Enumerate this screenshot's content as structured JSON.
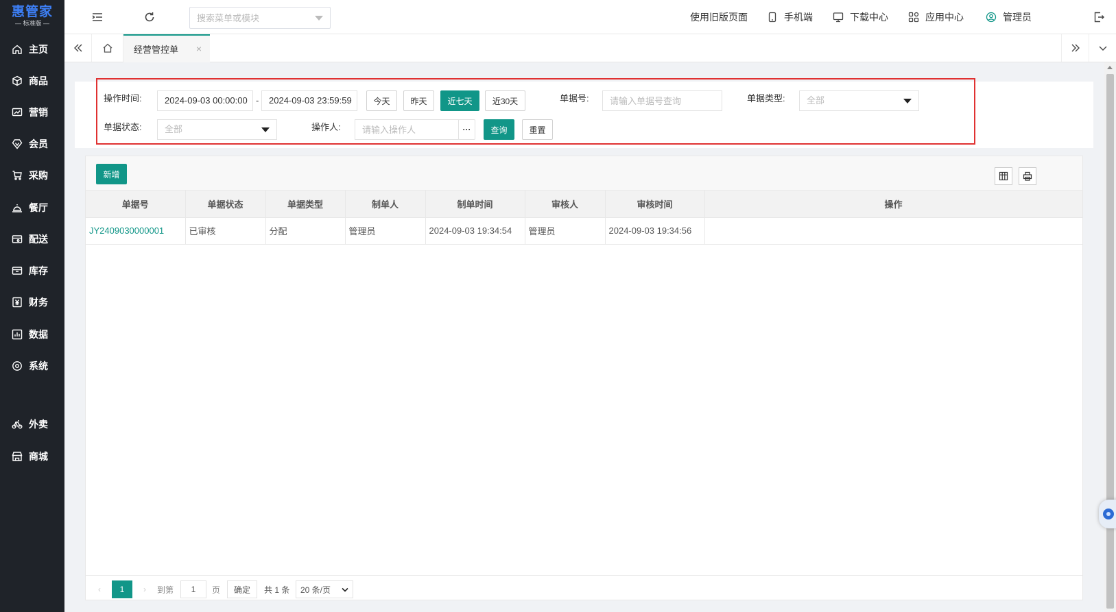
{
  "sidebar": {
    "brand": "惠管家",
    "edition": "— 标准版 —",
    "items": [
      {
        "label": "主页",
        "icon": "home-icon"
      },
      {
        "label": "商品",
        "icon": "cube-icon"
      },
      {
        "label": "营销",
        "icon": "chart-icon"
      },
      {
        "label": "会员",
        "icon": "diamond-icon"
      },
      {
        "label": "采购",
        "icon": "cart-icon"
      },
      {
        "label": "餐厅",
        "icon": "bell-icon"
      },
      {
        "label": "配送",
        "icon": "truck-icon"
      },
      {
        "label": "库存",
        "icon": "box-icon"
      },
      {
        "label": "财务",
        "icon": "yen-icon"
      },
      {
        "label": "数据",
        "icon": "bar-chart-icon"
      },
      {
        "label": "系统",
        "icon": "gear-icon"
      },
      {
        "label": "外卖",
        "icon": "bike-icon"
      },
      {
        "label": "商城",
        "icon": "shop-icon"
      }
    ]
  },
  "topbar": {
    "search_placeholder": "搜索菜单或模块",
    "old_page": "使用旧版页面",
    "mobile": "手机端",
    "download": "下载中心",
    "apps": "应用中心",
    "user": "管理员"
  },
  "tabs": {
    "active": "经营管控单"
  },
  "filter": {
    "op_time_label": "操作时间:",
    "start_time": "2024-09-03 00:00:00",
    "end_time": "2024-09-03 23:59:59",
    "today": "今天",
    "yesterday": "昨天",
    "last7": "近七天",
    "last30": "近30天",
    "doc_no_label": "单据号:",
    "doc_no_placeholder": "请输入单据号查询",
    "doc_type_label": "单据类型:",
    "doc_type_value": "全部",
    "status_label": "单据状态:",
    "status_value": "全部",
    "operator_label": "操作人:",
    "operator_placeholder": "请输入操作人",
    "more": "···",
    "query": "查询",
    "reset": "重置"
  },
  "toolbar": {
    "add": "新增"
  },
  "table": {
    "headers": [
      "单据号",
      "单据状态",
      "单据类型",
      "制单人",
      "制单时间",
      "审核人",
      "审核时间",
      "操作"
    ],
    "rows": [
      [
        "JY2409030000001",
        "已审核",
        "分配",
        "管理员",
        "2024-09-03 19:34:54",
        "管理员",
        "2024-09-03 19:34:56",
        ""
      ]
    ]
  },
  "pager": {
    "current": "1",
    "goto_label": "到第",
    "goto_value": "1",
    "page_unit": "页",
    "confirm": "确定",
    "total": "共 1 条",
    "page_size": "20 条/页"
  }
}
